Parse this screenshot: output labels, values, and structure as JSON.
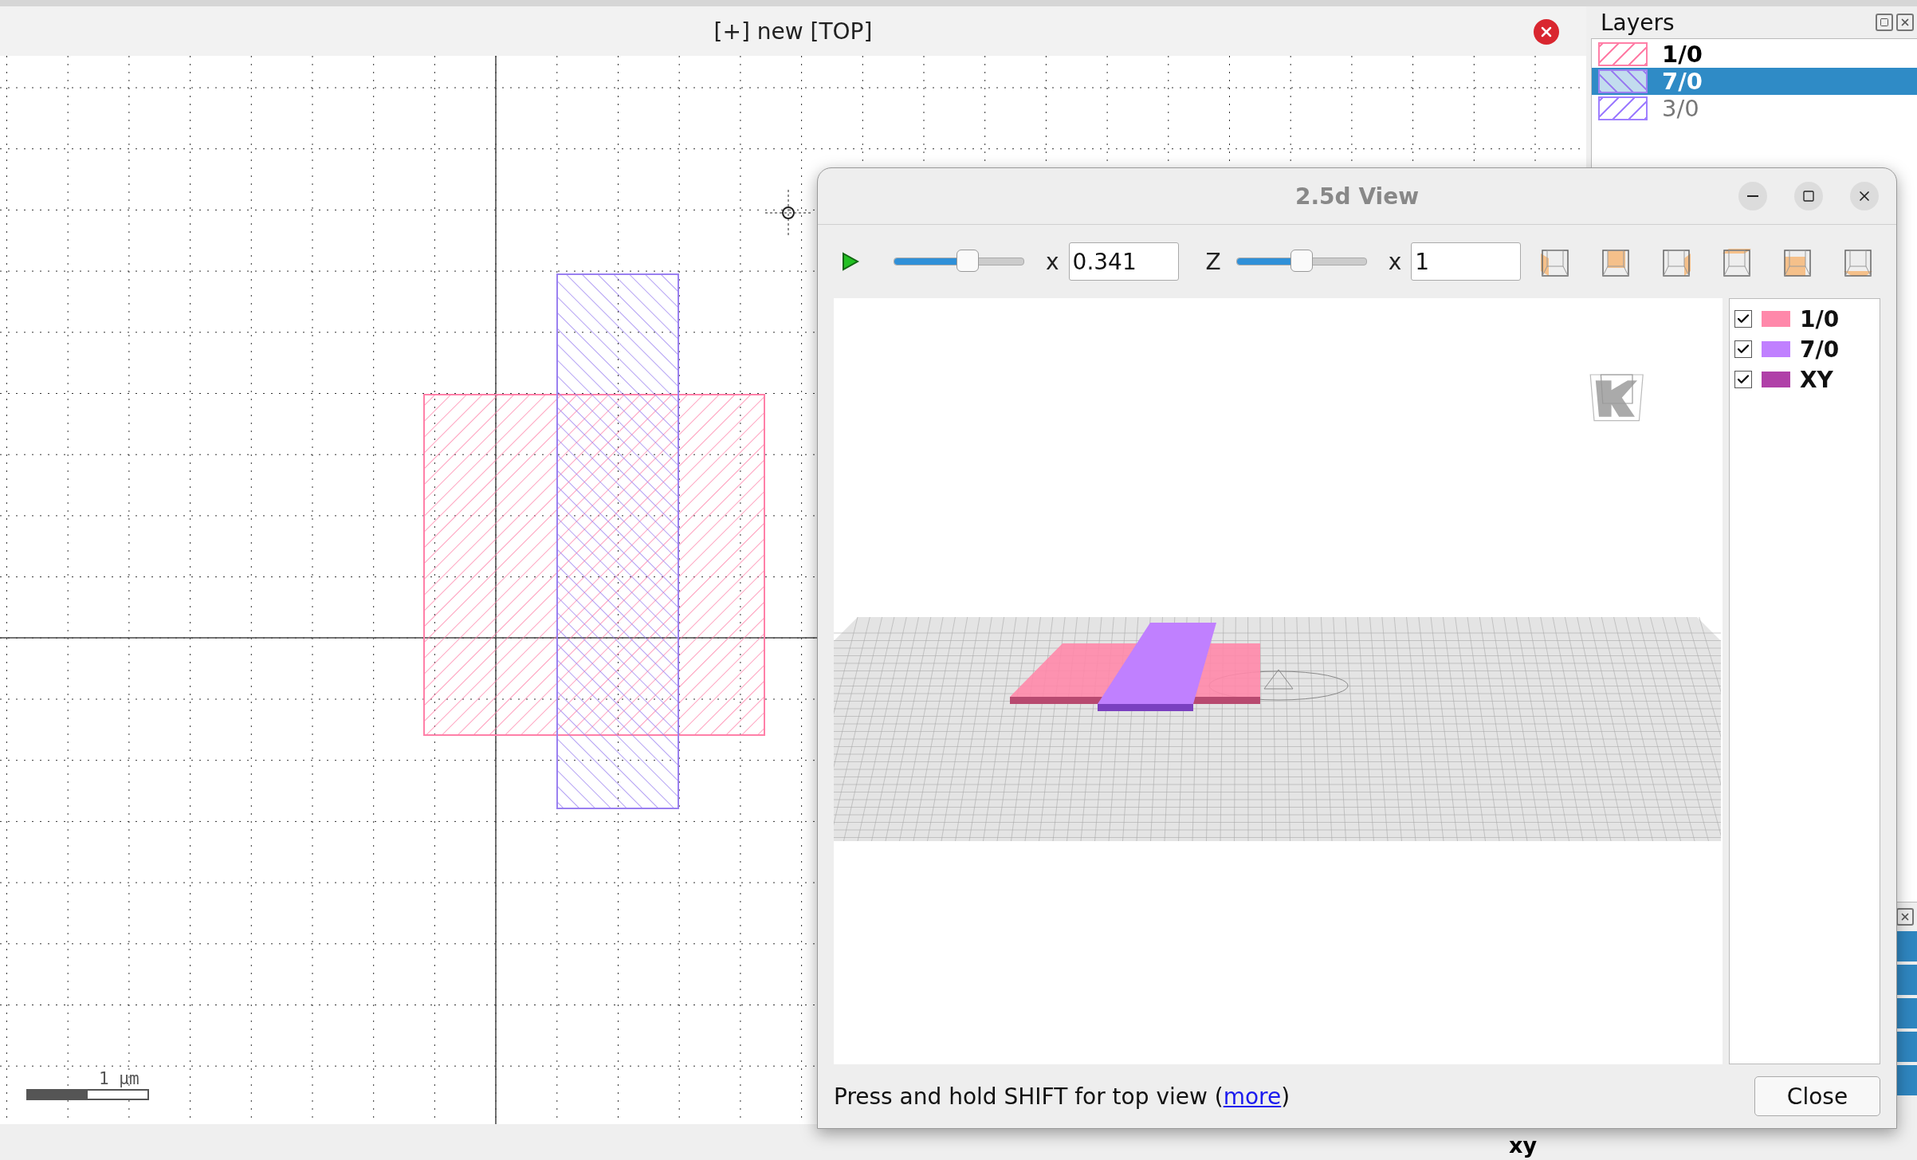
{
  "main_view": {
    "title": "[+] new [TOP]",
    "scale_label": "1 µm"
  },
  "layers_panel": {
    "title": "Layers",
    "layers": [
      {
        "name": "1/0",
        "color": "#ff80a8",
        "selected": false,
        "visible": true
      },
      {
        "name": "7/0",
        "color": "#9a80f0",
        "selected": true,
        "visible": true
      },
      {
        "name": "3/0",
        "color": "#a080ff",
        "selected": false,
        "visible": false
      }
    ]
  },
  "dialog": {
    "title": "2.5d View",
    "toolbar": {
      "scale_label": "x",
      "scale_value": "0.341",
      "scale_slider": {
        "level": 0.57
      },
      "z_label": "Z",
      "z_slider": {
        "level": 0.5
      },
      "z_factor_label": "x",
      "z_value": "1"
    },
    "legend": [
      {
        "label": "1/0",
        "color": "#ff88aa",
        "checked": true
      },
      {
        "label": "7/0",
        "color": "#c080ff",
        "checked": true
      },
      {
        "label": "XY",
        "color": "#b040a8",
        "checked": true
      }
    ],
    "hint": {
      "before": "Press and hold SHIFT for top view (",
      "link": "more",
      "after": ")"
    },
    "close_button": "Close"
  },
  "status": {
    "label": "xy"
  }
}
